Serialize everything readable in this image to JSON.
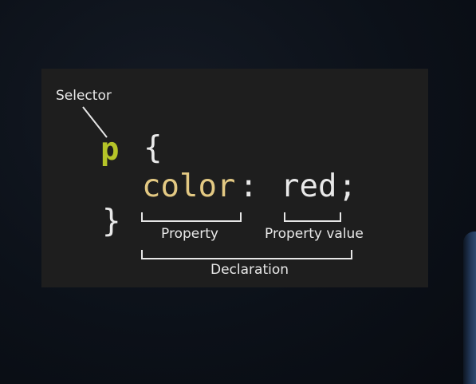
{
  "diagram": {
    "selector_label": "Selector",
    "code": {
      "selector": "p",
      "open_brace": "{",
      "property": "color",
      "colon": ":",
      "value": "red",
      "semicolon": ";",
      "close_brace": "}"
    },
    "property_label": "Property",
    "property_value_label": "Property value",
    "declaration_label": "Declaration"
  },
  "colors": {
    "background": "#0c1119",
    "panel": "#1e1e1e",
    "selector": "#b5c428",
    "property": "#e3c983",
    "text": "#e9e9e9"
  }
}
